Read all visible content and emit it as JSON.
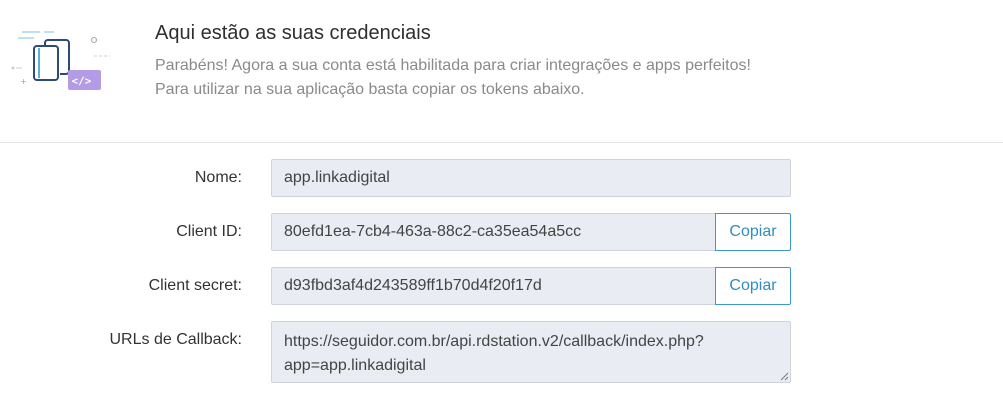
{
  "header": {
    "title": "Aqui estão as suas credenciais",
    "subtitle_line1": "Parabéns! Agora a sua conta está habilitada para criar integrações e apps perfeitos!",
    "subtitle_line2": "Para utilizar na sua aplicação basta copiar os tokens abaixo.",
    "illustration_icon": "code-windows-illustration",
    "accent_color": "#b49be6"
  },
  "form": {
    "name": {
      "label": "Nome:",
      "value": "app.linkadigital"
    },
    "client_id": {
      "label": "Client ID:",
      "value": "80efd1ea-7cb4-463a-88c2-ca35ea54a5cc",
      "copy_label": "Copiar"
    },
    "client_secret": {
      "label": "Client secret:",
      "value": "d93fbd3af4d243589ff1b70d4f20f17d",
      "copy_label": "Copiar"
    },
    "callback": {
      "label": "URLs de Callback:",
      "value": "https://seguidor.com.br/api.rdstation.v2/callback/index.php?app=app.linkadigital"
    }
  },
  "colors": {
    "button_border": "#3a9bc9",
    "button_text": "#2d8fc4",
    "field_bg": "#e9ecf2"
  }
}
